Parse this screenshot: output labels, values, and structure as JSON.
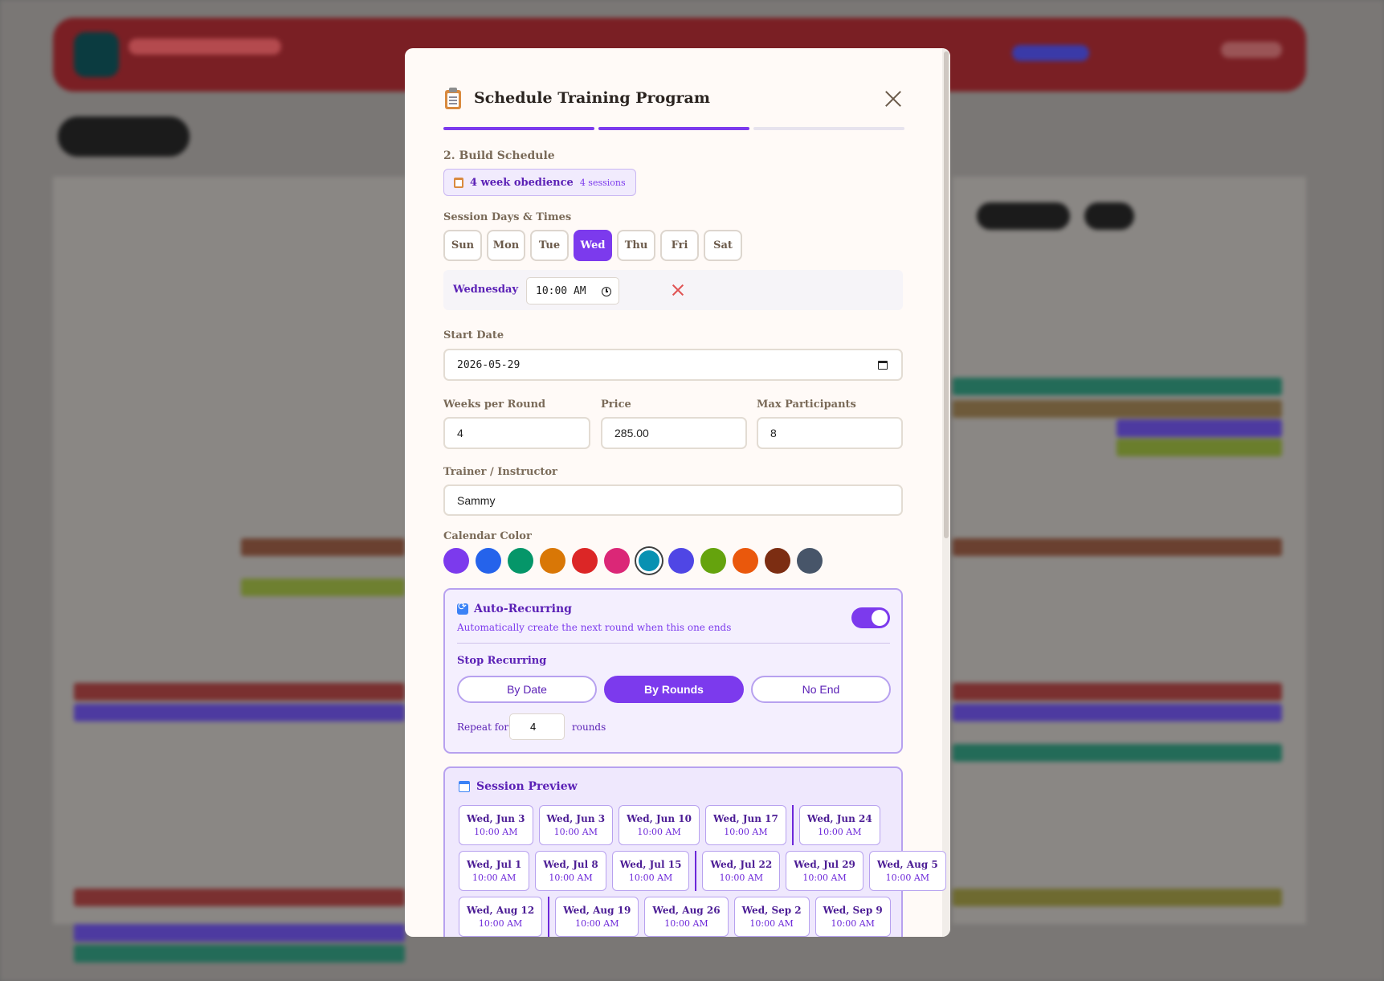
{
  "modal": {
    "title": "Schedule Training Program",
    "steps": [
      true,
      true,
      false
    ],
    "step_title": "2. Build Schedule",
    "program": {
      "name": "4 week obedience",
      "sessions": "4 sessions"
    },
    "days_label": "Session Days & Times",
    "days": [
      {
        "label": "Sun",
        "active": false
      },
      {
        "label": "Mon",
        "active": false
      },
      {
        "label": "Tue",
        "active": false
      },
      {
        "label": "Wed",
        "active": true
      },
      {
        "label": "Thu",
        "active": false
      },
      {
        "label": "Fri",
        "active": false
      },
      {
        "label": "Sat",
        "active": false
      }
    ],
    "time_slot": {
      "day": "Wednesday",
      "time": "10:00 AM"
    },
    "start_date_label": "Start Date",
    "start_date": "2026-05-29",
    "weeks_label": "Weeks per Round",
    "weeks": "4",
    "price_label": "Price",
    "price": "285.00",
    "max_label": "Max Participants",
    "max": "8",
    "trainer_label": "Trainer / Instructor",
    "trainer": "Sammy",
    "color_label": "Calendar Color",
    "colors": [
      "#7c3aed",
      "#2563eb",
      "#059669",
      "#d97706",
      "#dc2626",
      "#db2777",
      "#0891b2",
      "#4f46e5",
      "#65a30d",
      "#ea580c",
      "#7c2d12",
      "#475569"
    ],
    "selected_color_index": 6,
    "recurring": {
      "title": "Auto-Recurring",
      "desc": "Automatically create the next round when this one ends",
      "enabled": true,
      "stop_label": "Stop Recurring",
      "options": [
        {
          "label": "By Date",
          "active": false
        },
        {
          "label": "By Rounds",
          "active": true
        },
        {
          "label": "No End",
          "active": false
        }
      ],
      "repeat_label": "Repeat for:",
      "repeat_value": "4",
      "repeat_unit": "rounds"
    },
    "preview": {
      "title": "Session Preview",
      "rows": [
        [
          {
            "date": "Wed, Jun 3",
            "time": "10:00 AM"
          },
          {
            "date": "Wed, Jun 3",
            "time": "10:00 AM"
          },
          {
            "date": "Wed, Jun 10",
            "time": "10:00 AM"
          },
          {
            "date": "Wed, Jun 17",
            "time": "10:00 AM"
          },
          {
            "sep": true
          },
          {
            "date": "Wed, Jun 24",
            "time": "10:00 AM"
          }
        ],
        [
          {
            "date": "Wed, Jul 1",
            "time": "10:00 AM"
          },
          {
            "date": "Wed, Jul 8",
            "time": "10:00 AM"
          },
          {
            "date": "Wed, Jul 15",
            "time": "10:00 AM"
          },
          {
            "sep": true
          },
          {
            "date": "Wed, Jul 22",
            "time": "10:00 AM"
          },
          {
            "date": "Wed, Jul 29",
            "time": "10:00 AM"
          },
          {
            "date": "Wed, Aug 5",
            "time": "10:00 AM"
          }
        ],
        [
          {
            "date": "Wed, Aug 12",
            "time": "10:00 AM"
          },
          {
            "sep": true
          },
          {
            "date": "Wed, Aug 19",
            "time": "10:00 AM"
          },
          {
            "date": "Wed, Aug 26",
            "time": "10:00 AM"
          },
          {
            "date": "Wed, Sep 2",
            "time": "10:00 AM"
          },
          {
            "date": "Wed, Sep 9",
            "time": "10:00 AM"
          }
        ]
      ]
    }
  }
}
